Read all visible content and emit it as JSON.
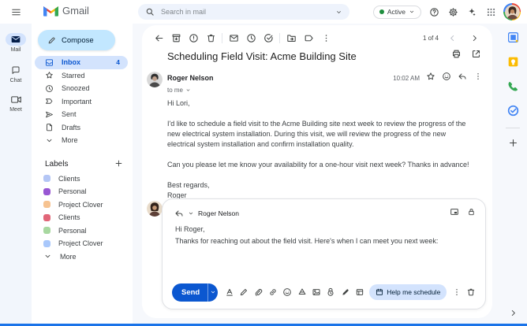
{
  "topbar": {
    "product": "Gmail",
    "search": {
      "placeholder": "Search in mail"
    },
    "status_chip": "Active"
  },
  "rail": {
    "items": [
      "Mail",
      "Chat",
      "Meet"
    ]
  },
  "sidebar": {
    "compose": "Compose",
    "nav": [
      {
        "label": "Inbox",
        "count": "4"
      },
      {
        "label": "Starred"
      },
      {
        "label": "Snoozed"
      },
      {
        "label": "Important"
      },
      {
        "label": "Sent"
      },
      {
        "label": "Drafts"
      },
      {
        "label": "More"
      }
    ],
    "labels_header": "Labels",
    "labels": [
      {
        "name": "Clients",
        "color": "#b4c6f5"
      },
      {
        "name": "Personal",
        "color": "#9857d3"
      },
      {
        "name": "Project Clover",
        "color": "#f6c391"
      },
      {
        "name": "Clients",
        "color": "#e16678"
      },
      {
        "name": "Personal",
        "color": "#a8d8a0"
      },
      {
        "name": "Project Clover",
        "color": "#a9c8fb"
      }
    ],
    "labels_more": "More"
  },
  "thread": {
    "toolbar": {
      "pagination": "1 of 4"
    },
    "subject": "Scheduling Field Visit: Acme Building Site",
    "message": {
      "sender": "Roger Nelson",
      "to": "to me",
      "time": "10:02 AM",
      "greeting": "Hi Lori,",
      "para1": "I'd like to schedule a field visit to the Acme Building site next week to review the progress of the new electrical system installation. During this visit, we will review the progress of the new electrical system installation and confirm installation quality.",
      "para2": "Can you please let me know your availability for a one-hour visit next week? Thanks in advance!",
      "signoff": "Best regards,",
      "signature": "Roger"
    },
    "reply": {
      "recipient": "Roger Nelson",
      "greeting": "Hi Roger,",
      "body": "Thanks for reaching out about the field visit. Here's when I can meet you next week:",
      "send": "Send",
      "assist_chip": "Help me schedule"
    }
  },
  "colors": {
    "accent_blue": "#0b57d0",
    "compose_pill": "#c2e7ff",
    "selected_pill": "#d3e3fd",
    "active_dot_green": "#1e8e3e",
    "bottom_edge": "#1a73e8"
  },
  "icons": {
    "hamburger": "three horizontal lines",
    "search": "magnifier",
    "active_chevron": "chevron-down",
    "help": "question in circle",
    "settings": "gear",
    "gemini": "four-point sparkle",
    "apps": "3x3 dot grid",
    "back": "left arrow",
    "archive": "box with down arrow",
    "report_spam": "circle exclamation",
    "delete": "trash can",
    "mark_unread": "envelope",
    "snooze": "clock",
    "add_to_tasks": "circle check",
    "move_to": "folder with arrow",
    "label": "tag",
    "more": "vertical dots",
    "print": "printer",
    "open_in_new": "box with arrow",
    "star": "star outline",
    "emoji_reaction": "smiley",
    "reply": "curved left arrow",
    "popout": "picture-in-picture square",
    "lock": "padlock",
    "formatting": "underlined A",
    "help_me_write": "pen",
    "attach": "paperclip",
    "insert_link": "chain link",
    "insert_emoji": "smiley",
    "drive": "triangle",
    "insert_photo": "picture frame",
    "confidential": "clock with lock shackle",
    "signature": "filled pen",
    "insert_template": "split square",
    "chip_calendar": "calendar",
    "discard_draft": "trash can",
    "panel_calendar": "calendar app",
    "panel_keep": "keep note app",
    "panel_voice": "green handset app",
    "panel_tasks": "tasks app",
    "panel_add": "plus",
    "panel_collapse": "chevron-right"
  }
}
